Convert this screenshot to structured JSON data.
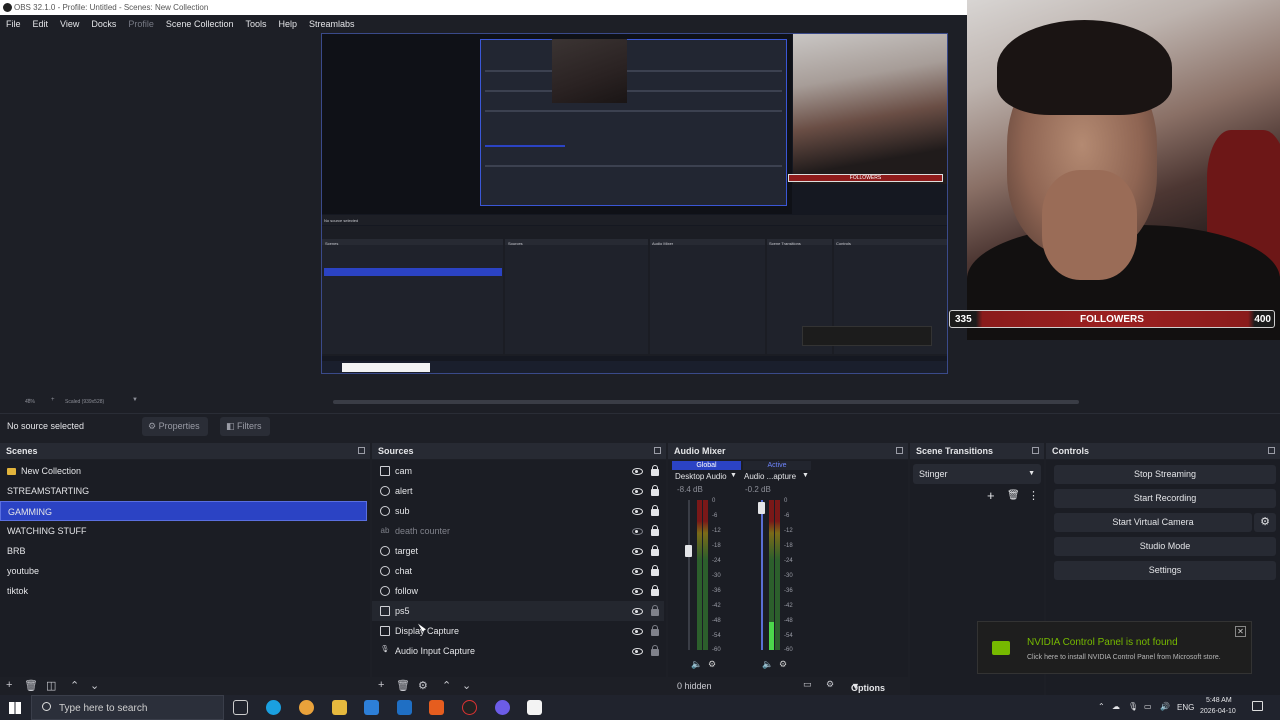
{
  "window": {
    "title": "OBS 32.1.0 - Profile: Untitled - Scenes: New Collection"
  },
  "menu": [
    "File",
    "Edit",
    "View",
    "Docks",
    "Profile",
    "Scene Collection",
    "Tools",
    "Help",
    "Streamlabs"
  ],
  "zoom": {
    "level": "48%",
    "scaled": "Scaled (939x528)"
  },
  "overlay": {
    "followers_current": "335",
    "followers_label": "FOLLOWERS",
    "followers_goal": "400"
  },
  "info_bar": {
    "status": "No source selected",
    "properties": "Properties",
    "filters": "Filters"
  },
  "scenes": {
    "title": "Scenes",
    "items": [
      {
        "label": "New Collection",
        "folder": true
      },
      {
        "label": "STREAMSTARTING"
      },
      {
        "label": "GAMMING",
        "selected": true
      },
      {
        "label": "WATCHING STUFF"
      },
      {
        "label": "BRB"
      },
      {
        "label": "youtube"
      },
      {
        "label": "tiktok"
      }
    ]
  },
  "sources": {
    "title": "Sources",
    "items": [
      {
        "label": "cam"
      },
      {
        "label": "alert"
      },
      {
        "label": "sub"
      },
      {
        "label": "death counter"
      },
      {
        "label": "target"
      },
      {
        "label": "chat"
      },
      {
        "label": "follow"
      },
      {
        "label": "ps5"
      },
      {
        "label": "Display Capture"
      },
      {
        "label": "Audio Input Capture"
      }
    ]
  },
  "audio_mixer": {
    "title": "Audio Mixer",
    "tabs": [
      "Global",
      "Active"
    ],
    "channels": [
      {
        "name": "Desktop Audio",
        "db": "-8.4 dB"
      },
      {
        "name": "Audio ...apture",
        "db": "-0.2 dB"
      }
    ],
    "scale": [
      "0",
      "-6",
      "-12",
      "-18",
      "-24",
      "-30",
      "-36",
      "-42",
      "-48",
      "-54",
      "-60"
    ],
    "hidden": "0 hidden",
    "options": "Options"
  },
  "scene_transitions": {
    "title": "Scene Transitions",
    "selected": "Stinger"
  },
  "controls": {
    "title": "Controls",
    "buttons": [
      "Stop Streaming",
      "Start Recording",
      "Start Virtual Camera",
      "Studio Mode",
      "Settings"
    ]
  },
  "toast": {
    "title": "NVIDIA Control Panel is not found",
    "body": "Click here to install NVIDIA Control Panel from Microsoft store."
  },
  "taskbar": {
    "search_placeholder": "Type here to search",
    "lang": "ENG",
    "time": "5:48 AM",
    "date": "2026-04-10"
  },
  "mini": {
    "no_source": "No source selected",
    "scenes": "Scenes",
    "sources": "Sources",
    "audio_mixer": "Audio Mixer",
    "scene_transitions": "Scene Transitions",
    "controls": "Controls"
  }
}
